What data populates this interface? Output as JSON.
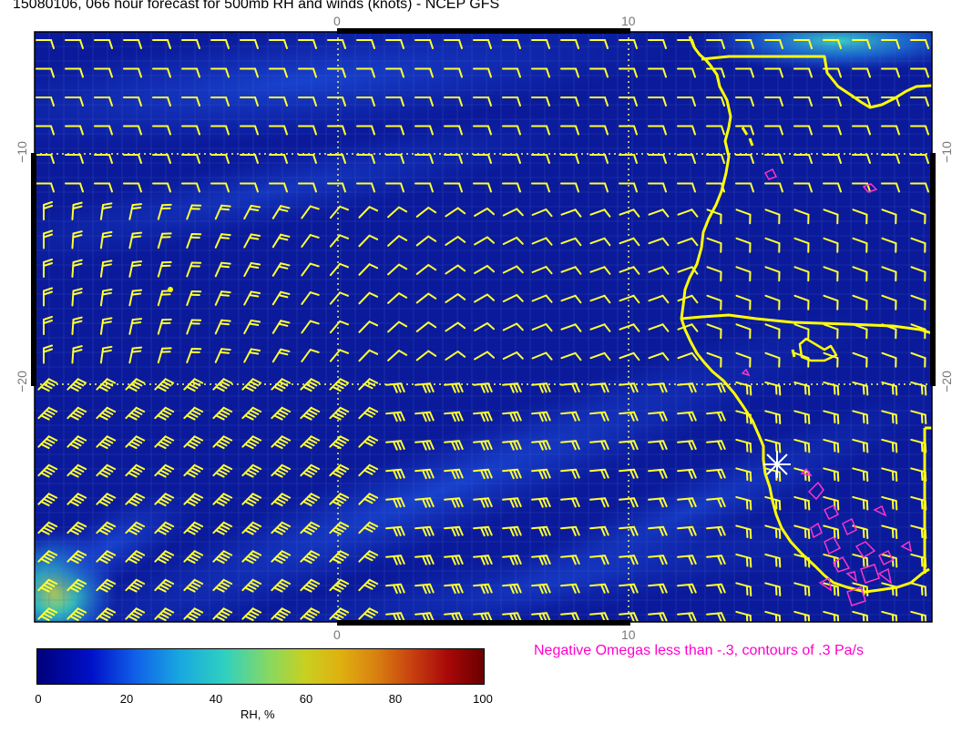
{
  "title": "15080106, 066 hour forecast for 500mb RH and winds (knots) - NCEP GFS",
  "map": {
    "lon_ticks": [
      "0",
      "10",
      "0",
      "10"
    ],
    "lat_ticks_left": [
      "−10",
      "−20"
    ],
    "lat_ticks_right": [
      "−10",
      "−20"
    ],
    "background_color": "#0a1a9a",
    "coast_color": "#ffff00",
    "barb_color": "#ffff33",
    "omega_color": "#ff33cc",
    "marker_color": "#ffffff"
  },
  "colorbar": {
    "ticks": [
      "0",
      "20",
      "40",
      "60",
      "80",
      "100"
    ],
    "title": "RH, %"
  },
  "omega_note": "Negative Omegas less than -.3, contours of .3 Pa/s"
}
